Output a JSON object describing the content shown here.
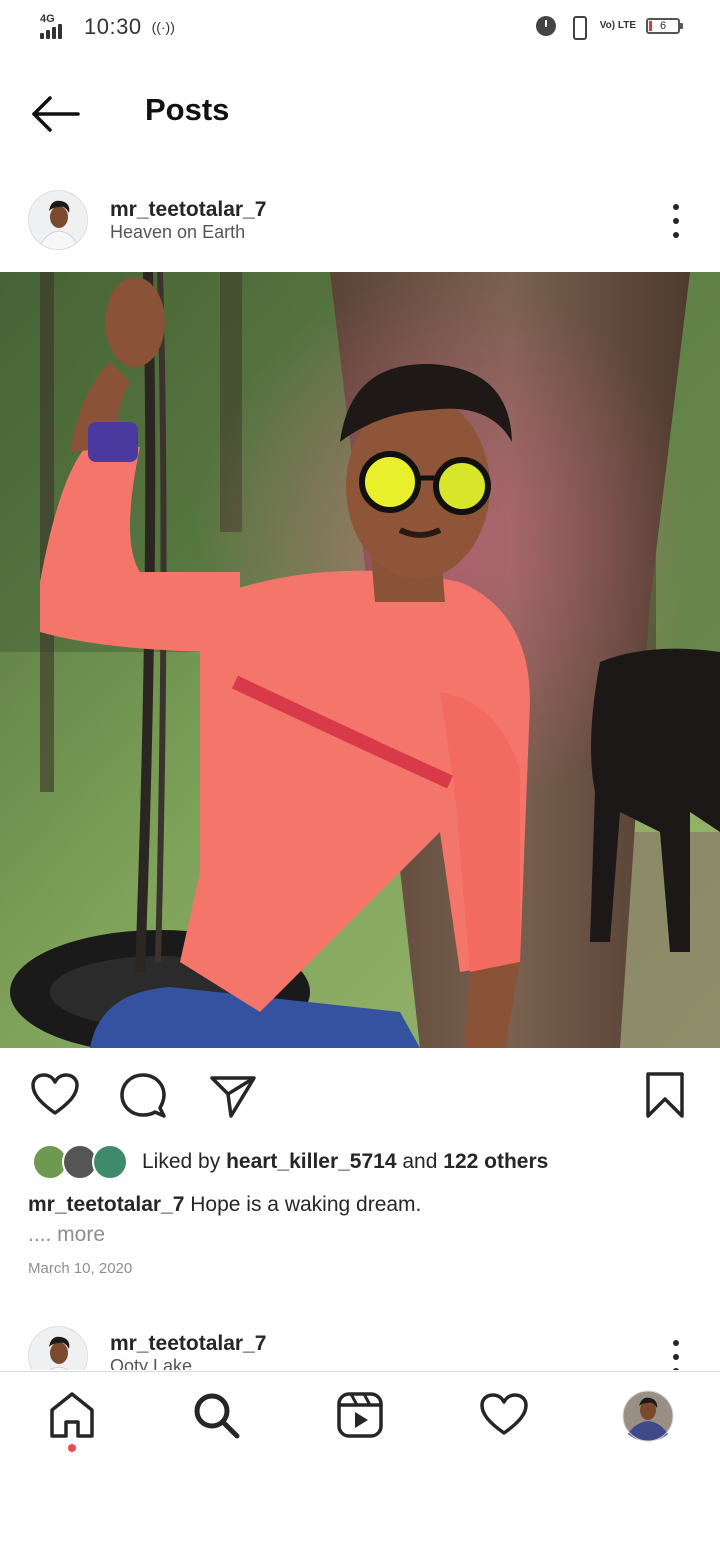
{
  "status_bar": {
    "network": "4G",
    "time": "10:30",
    "hotspot_icon": "((·))",
    "volte": "Vo) LTE",
    "battery": "6"
  },
  "header": {
    "title": "Posts"
  },
  "post": {
    "username": "mr_teetotalar_7",
    "location": "Heaven on Earth",
    "image_alt": "photo-post",
    "likes_prefix": "Liked by",
    "liked_by_user": "heart_killer_5714",
    "likes_and": "and",
    "likes_others": "122 others",
    "caption_user": "mr_teetotalar_7",
    "caption_text": "Hope is a waking dream.",
    "more_label": ".... more",
    "date": "March 10, 2020"
  },
  "next_post": {
    "username": "mr_teetotalar_7",
    "location": "Ooty Lake"
  },
  "icons": {
    "back": "arrow-left-icon",
    "like": "heart-icon",
    "comment": "comment-icon",
    "share": "send-icon",
    "save": "bookmark-icon",
    "home": "home-icon",
    "search": "search-icon",
    "reels": "reels-icon",
    "activity": "heart-icon",
    "profile": "profile-avatar"
  },
  "colors": {
    "notification_dot": "#ed4956",
    "text_primary": "#262626",
    "text_secondary": "#8e8e8e"
  }
}
